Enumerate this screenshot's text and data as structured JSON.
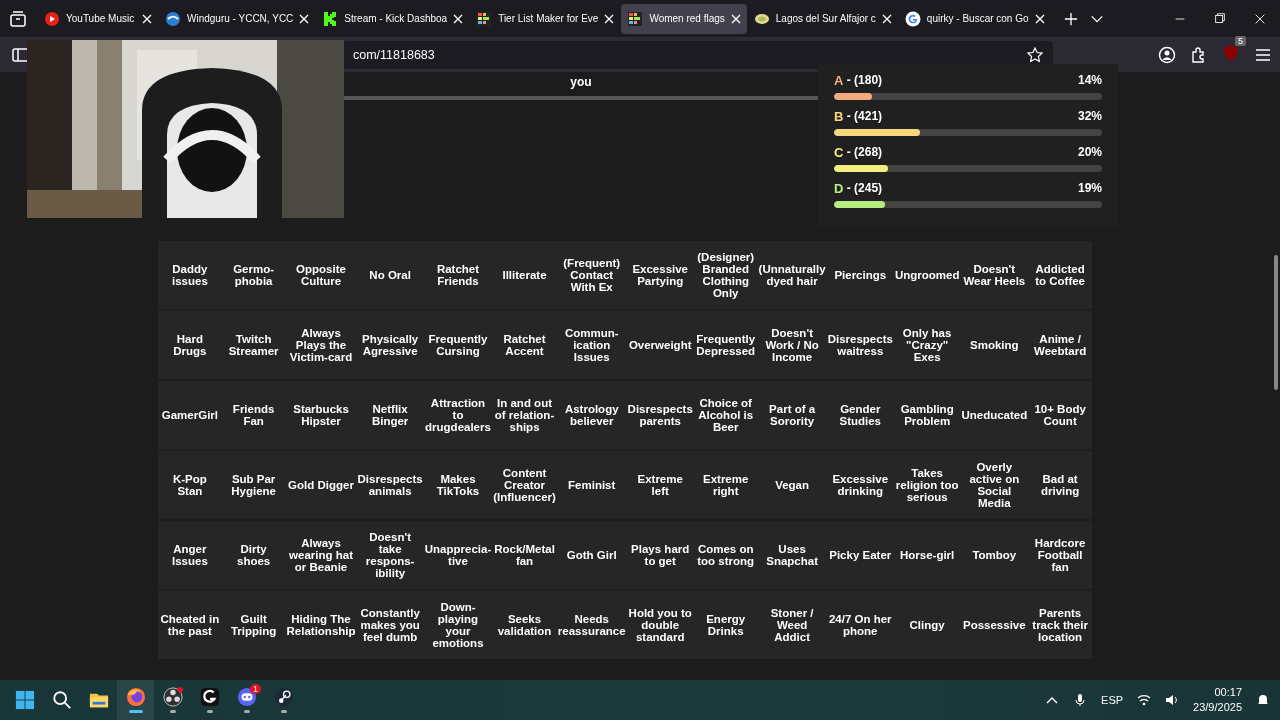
{
  "browser": {
    "tabs": [
      {
        "title": "YouTube Music",
        "kind": "youtube",
        "selected": false
      },
      {
        "title": "Windguru - YCCN, YCC",
        "kind": "windguru",
        "selected": false
      },
      {
        "title": "Stream - Kick Dashboa",
        "kind": "kick",
        "selected": false
      },
      {
        "title": "Tier List Maker for Eve",
        "kind": "tierlist",
        "selected": false
      },
      {
        "title": "Women red flags",
        "kind": "tierlist",
        "selected": true
      },
      {
        "title": "Lagos del Sur Alfajor c",
        "kind": "alfajor",
        "selected": false
      },
      {
        "title": "quirky - Buscar con Go",
        "kind": "google",
        "selected": false
      }
    ],
    "address": "com/11818683",
    "extension_badge": "5"
  },
  "page": {
    "top_cell": "you",
    "tier_stats": [
      {
        "tier": "A",
        "count": "- (180)",
        "percent": "14%",
        "level": 0.14,
        "color": "#f5a97f"
      },
      {
        "tier": "B",
        "count": "- (421)",
        "percent": "32%",
        "level": 0.32,
        "color": "#f7d77e"
      },
      {
        "tier": "C",
        "count": "- (268)",
        "percent": "20%",
        "level": 0.2,
        "color": "#f4ee80"
      },
      {
        "tier": "D",
        "count": "- (245)",
        "percent": "19%",
        "level": 0.19,
        "color": "#b5ee7e"
      }
    ],
    "cards": [
      [
        "Daddy issues",
        "Germo-phobia",
        "Opposite Culture",
        "No Oral",
        "Ratchet Friends",
        "Illiterate",
        "(Frequent) Contact With Ex",
        "Excessive Partying",
        "(Designer) Branded Clothing Only",
        "(Unnaturally dyed hair",
        "Piercings",
        "Ungroomed",
        "Doesn't Wear Heels",
        "Addicted to Coffee"
      ],
      [
        "Hard Drugs",
        "Twitch Streamer",
        "Always Plays the Victim-card",
        "Physically Agressive",
        "Frequently Cursing",
        "Ratchet Accent",
        "Commun-ication Issues",
        "Overweight",
        "Frequently Depressed",
        "Doesn't Work / No Income",
        "Disrespects waitress",
        "Only has \"Crazy\" Exes",
        "Smoking",
        "Anime / Weebtard"
      ],
      [
        "GamerGirl",
        "Friends Fan",
        "Starbucks Hipster",
        "Netflix Binger",
        "Attraction to drugdealers",
        "In and out of relation-ships",
        "Astrology believer",
        "Disrespects parents",
        "Choice of Alcohol is Beer",
        "Part of a Sorority",
        "Gender Studies",
        "Gambling Problem",
        "Uneducated",
        "10+ Body Count"
      ],
      [
        "K-Pop Stan",
        "Sub Par Hygiene",
        "Gold Digger",
        "Disrespects animals",
        "Makes TikToks",
        "Content Creator (Influencer)",
        "Feminist",
        "Extreme left",
        "Extreme right",
        "Vegan",
        "Excessive drinking",
        "Takes religion too serious",
        "Overly active on Social Media",
        "Bad at driving"
      ],
      [
        "Anger Issues",
        "Dirty shoes",
        "Always wearing hat or Beanie",
        "Doesn't take respons-ibility",
        "Unapprecia-tive",
        "Rock/Metal fan",
        "Goth Girl",
        "Plays hard to get",
        "Comes on too strong",
        "Uses Snapchat",
        "Picky Eater",
        "Horse-girl",
        "Tomboy",
        "Hardcore Football fan"
      ],
      [
        "Cheated in the past",
        "Guilt Tripping",
        "Hiding The Relationship",
        "Constantly makes you feel dumb",
        "Down-playing your emotions",
        "Seeks validation",
        "Needs reassurance",
        "Hold you to double standard",
        "Energy Drinks",
        "Stoner / Weed Addict",
        "24/7 On her phone",
        "Clingy",
        "Possessive",
        "Parents track their location"
      ]
    ]
  },
  "taskbar": {
    "apps": [
      {
        "kind": "start",
        "active": false
      },
      {
        "kind": "search",
        "active": false
      },
      {
        "kind": "files",
        "active": false
      },
      {
        "kind": "firefox",
        "active": true
      },
      {
        "kind": "obs",
        "active": false
      },
      {
        "kind": "ghub",
        "active": false
      },
      {
        "kind": "discord",
        "active": false,
        "badge": "1"
      },
      {
        "kind": "steam",
        "active": false
      }
    ],
    "language": "ESP",
    "time": "00:17",
    "date": "23/9/2025"
  }
}
